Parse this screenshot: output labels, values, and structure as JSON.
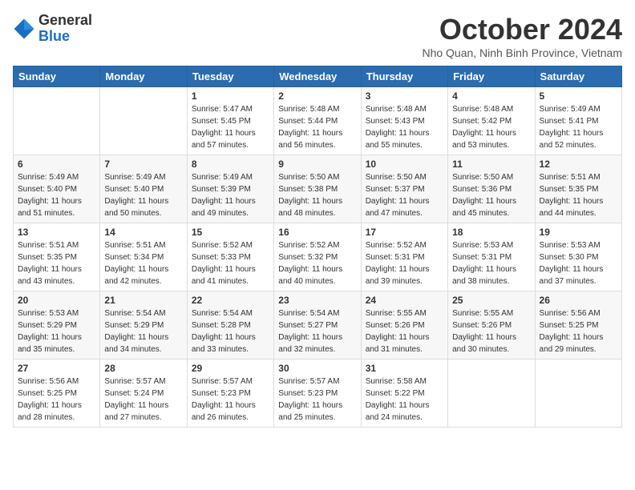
{
  "header": {
    "logo_general": "General",
    "logo_blue": "Blue",
    "month_title": "October 2024",
    "location": "Nho Quan, Ninh Binh Province, Vietnam"
  },
  "weekdays": [
    "Sunday",
    "Monday",
    "Tuesday",
    "Wednesday",
    "Thursday",
    "Friday",
    "Saturday"
  ],
  "weeks": [
    [
      {
        "day": "",
        "sunrise": "",
        "sunset": "",
        "daylight": ""
      },
      {
        "day": "",
        "sunrise": "",
        "sunset": "",
        "daylight": ""
      },
      {
        "day": "1",
        "sunrise": "Sunrise: 5:47 AM",
        "sunset": "Sunset: 5:45 PM",
        "daylight": "Daylight: 11 hours and 57 minutes."
      },
      {
        "day": "2",
        "sunrise": "Sunrise: 5:48 AM",
        "sunset": "Sunset: 5:44 PM",
        "daylight": "Daylight: 11 hours and 56 minutes."
      },
      {
        "day": "3",
        "sunrise": "Sunrise: 5:48 AM",
        "sunset": "Sunset: 5:43 PM",
        "daylight": "Daylight: 11 hours and 55 minutes."
      },
      {
        "day": "4",
        "sunrise": "Sunrise: 5:48 AM",
        "sunset": "Sunset: 5:42 PM",
        "daylight": "Daylight: 11 hours and 53 minutes."
      },
      {
        "day": "5",
        "sunrise": "Sunrise: 5:49 AM",
        "sunset": "Sunset: 5:41 PM",
        "daylight": "Daylight: 11 hours and 52 minutes."
      }
    ],
    [
      {
        "day": "6",
        "sunrise": "Sunrise: 5:49 AM",
        "sunset": "Sunset: 5:40 PM",
        "daylight": "Daylight: 11 hours and 51 minutes."
      },
      {
        "day": "7",
        "sunrise": "Sunrise: 5:49 AM",
        "sunset": "Sunset: 5:40 PM",
        "daylight": "Daylight: 11 hours and 50 minutes."
      },
      {
        "day": "8",
        "sunrise": "Sunrise: 5:49 AM",
        "sunset": "Sunset: 5:39 PM",
        "daylight": "Daylight: 11 hours and 49 minutes."
      },
      {
        "day": "9",
        "sunrise": "Sunrise: 5:50 AM",
        "sunset": "Sunset: 5:38 PM",
        "daylight": "Daylight: 11 hours and 48 minutes."
      },
      {
        "day": "10",
        "sunrise": "Sunrise: 5:50 AM",
        "sunset": "Sunset: 5:37 PM",
        "daylight": "Daylight: 11 hours and 47 minutes."
      },
      {
        "day": "11",
        "sunrise": "Sunrise: 5:50 AM",
        "sunset": "Sunset: 5:36 PM",
        "daylight": "Daylight: 11 hours and 45 minutes."
      },
      {
        "day": "12",
        "sunrise": "Sunrise: 5:51 AM",
        "sunset": "Sunset: 5:35 PM",
        "daylight": "Daylight: 11 hours and 44 minutes."
      }
    ],
    [
      {
        "day": "13",
        "sunrise": "Sunrise: 5:51 AM",
        "sunset": "Sunset: 5:35 PM",
        "daylight": "Daylight: 11 hours and 43 minutes."
      },
      {
        "day": "14",
        "sunrise": "Sunrise: 5:51 AM",
        "sunset": "Sunset: 5:34 PM",
        "daylight": "Daylight: 11 hours and 42 minutes."
      },
      {
        "day": "15",
        "sunrise": "Sunrise: 5:52 AM",
        "sunset": "Sunset: 5:33 PM",
        "daylight": "Daylight: 11 hours and 41 minutes."
      },
      {
        "day": "16",
        "sunrise": "Sunrise: 5:52 AM",
        "sunset": "Sunset: 5:32 PM",
        "daylight": "Daylight: 11 hours and 40 minutes."
      },
      {
        "day": "17",
        "sunrise": "Sunrise: 5:52 AM",
        "sunset": "Sunset: 5:31 PM",
        "daylight": "Daylight: 11 hours and 39 minutes."
      },
      {
        "day": "18",
        "sunrise": "Sunrise: 5:53 AM",
        "sunset": "Sunset: 5:31 PM",
        "daylight": "Daylight: 11 hours and 38 minutes."
      },
      {
        "day": "19",
        "sunrise": "Sunrise: 5:53 AM",
        "sunset": "Sunset: 5:30 PM",
        "daylight": "Daylight: 11 hours and 37 minutes."
      }
    ],
    [
      {
        "day": "20",
        "sunrise": "Sunrise: 5:53 AM",
        "sunset": "Sunset: 5:29 PM",
        "daylight": "Daylight: 11 hours and 35 minutes."
      },
      {
        "day": "21",
        "sunrise": "Sunrise: 5:54 AM",
        "sunset": "Sunset: 5:29 PM",
        "daylight": "Daylight: 11 hours and 34 minutes."
      },
      {
        "day": "22",
        "sunrise": "Sunrise: 5:54 AM",
        "sunset": "Sunset: 5:28 PM",
        "daylight": "Daylight: 11 hours and 33 minutes."
      },
      {
        "day": "23",
        "sunrise": "Sunrise: 5:54 AM",
        "sunset": "Sunset: 5:27 PM",
        "daylight": "Daylight: 11 hours and 32 minutes."
      },
      {
        "day": "24",
        "sunrise": "Sunrise: 5:55 AM",
        "sunset": "Sunset: 5:26 PM",
        "daylight": "Daylight: 11 hours and 31 minutes."
      },
      {
        "day": "25",
        "sunrise": "Sunrise: 5:55 AM",
        "sunset": "Sunset: 5:26 PM",
        "daylight": "Daylight: 11 hours and 30 minutes."
      },
      {
        "day": "26",
        "sunrise": "Sunrise: 5:56 AM",
        "sunset": "Sunset: 5:25 PM",
        "daylight": "Daylight: 11 hours and 29 minutes."
      }
    ],
    [
      {
        "day": "27",
        "sunrise": "Sunrise: 5:56 AM",
        "sunset": "Sunset: 5:25 PM",
        "daylight": "Daylight: 11 hours and 28 minutes."
      },
      {
        "day": "28",
        "sunrise": "Sunrise: 5:57 AM",
        "sunset": "Sunset: 5:24 PM",
        "daylight": "Daylight: 11 hours and 27 minutes."
      },
      {
        "day": "29",
        "sunrise": "Sunrise: 5:57 AM",
        "sunset": "Sunset: 5:23 PM",
        "daylight": "Daylight: 11 hours and 26 minutes."
      },
      {
        "day": "30",
        "sunrise": "Sunrise: 5:57 AM",
        "sunset": "Sunset: 5:23 PM",
        "daylight": "Daylight: 11 hours and 25 minutes."
      },
      {
        "day": "31",
        "sunrise": "Sunrise: 5:58 AM",
        "sunset": "Sunset: 5:22 PM",
        "daylight": "Daylight: 11 hours and 24 minutes."
      },
      {
        "day": "",
        "sunrise": "",
        "sunset": "",
        "daylight": ""
      },
      {
        "day": "",
        "sunrise": "",
        "sunset": "",
        "daylight": ""
      }
    ]
  ]
}
